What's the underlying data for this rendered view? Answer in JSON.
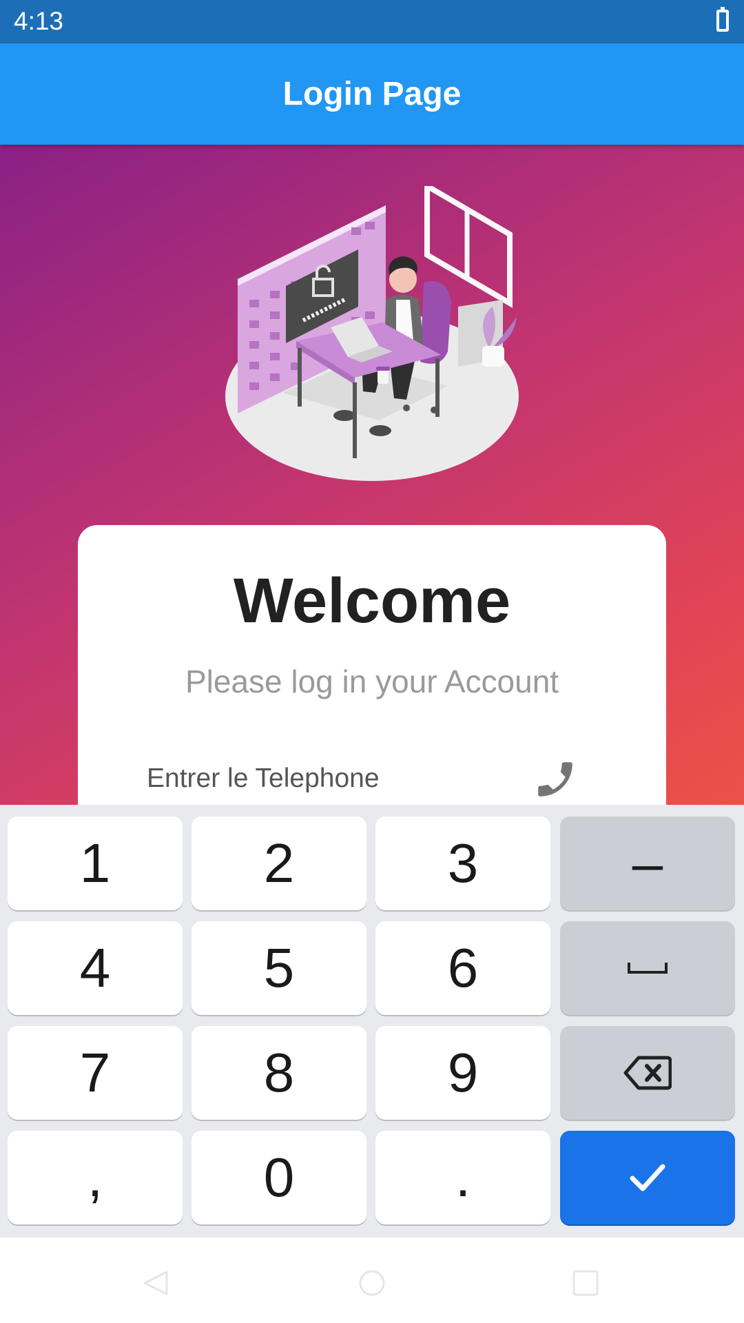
{
  "status_bar": {
    "time": "4:13",
    "battery_icon": "battery-icon"
  },
  "app_bar": {
    "title": "Login Page"
  },
  "colors": {
    "app_bar": "#2196f3",
    "status_bar": "#1c6fb6",
    "gradient_start": "#8a2185",
    "gradient_end": "#ec5247",
    "keyboard_bg": "#e8eaed",
    "done_key": "#1a73e8"
  },
  "card": {
    "title": "Welcome",
    "subtitle": "Please log in your Account",
    "phone_field": {
      "placeholder": "Entrer le Telephone",
      "icon": "phone-icon"
    }
  },
  "keyboard": {
    "keys": [
      {
        "label": "1"
      },
      {
        "label": "2"
      },
      {
        "label": "3"
      },
      {
        "label": "–",
        "icon": "dash-key"
      },
      {
        "label": "4"
      },
      {
        "label": "5"
      },
      {
        "label": "6"
      },
      {
        "label": "",
        "icon": "space-icon"
      },
      {
        "label": "7"
      },
      {
        "label": "8"
      },
      {
        "label": "9"
      },
      {
        "label": "",
        "icon": "backspace-icon"
      },
      {
        "label": ","
      },
      {
        "label": "0"
      },
      {
        "label": "."
      },
      {
        "label": "",
        "icon": "check-icon"
      }
    ]
  },
  "nav_bar": {
    "buttons": [
      "back-icon",
      "home-icon",
      "recents-icon"
    ]
  }
}
